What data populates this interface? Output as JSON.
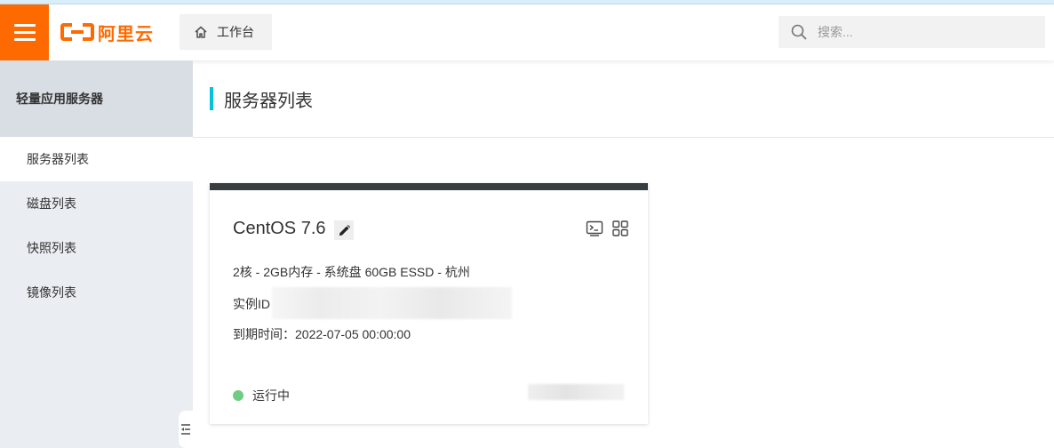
{
  "header": {
    "logo_text": "阿里云",
    "workbench_label": "工作台",
    "search_placeholder": "搜索..."
  },
  "sidebar": {
    "title": "轻量应用服务器",
    "items": [
      {
        "label": "服务器列表",
        "active": true
      },
      {
        "label": "磁盘列表",
        "active": false
      },
      {
        "label": "快照列表",
        "active": false
      },
      {
        "label": "镜像列表",
        "active": false
      }
    ]
  },
  "main": {
    "title": "服务器列表"
  },
  "server_card": {
    "name": "CentOS 7.6",
    "spec": "2核 - 2GB内存 - 系统盘 60GB ESSD - 杭州",
    "instance_id_label": "实例ID",
    "expire": "到期时间：2022-07-05 00:00:00",
    "status": "运行中",
    "status_color": "#6fcc82"
  },
  "colors": {
    "brand": "#ff6a00",
    "accent": "#00c1de",
    "card_header": "#373d41"
  },
  "icons": {
    "menu": "hamburger-icon",
    "home": "home-icon",
    "search": "search-icon",
    "edit": "pencil-icon",
    "terminal": "terminal-icon",
    "apps": "grid-icon",
    "collapse": "sidebar-collapse-icon"
  }
}
